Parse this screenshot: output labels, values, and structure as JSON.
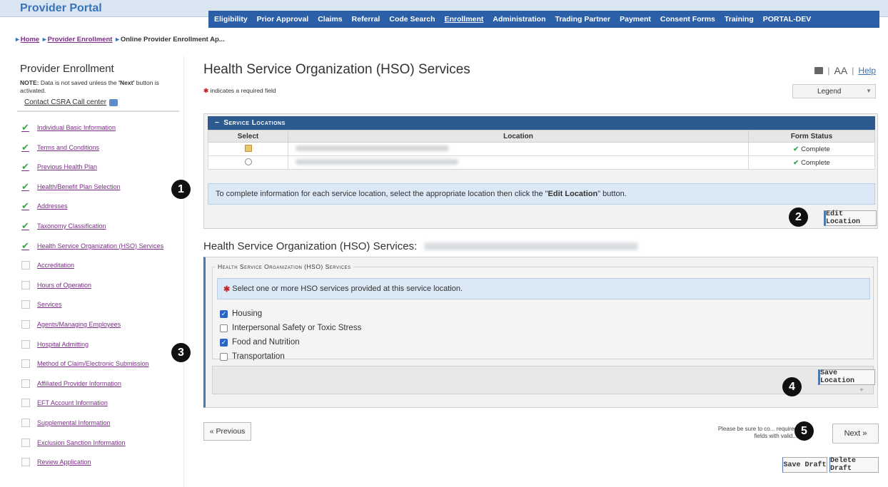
{
  "header": {
    "brand": "Provider Portal",
    "nav": [
      "Eligibility",
      "Prior Approval",
      "Claims",
      "Referral",
      "Code Search",
      "Enrollment",
      "Administration",
      "Trading Partner",
      "Payment",
      "Consent Forms",
      "Training",
      "PORTAL-DEV"
    ],
    "active_nav": "Enrollment"
  },
  "breadcrumb": {
    "home": "Home",
    "enrollment": "Provider Enrollment",
    "current": "Online Provider Enrollment Ap..."
  },
  "sidebar": {
    "title": "Provider Enrollment",
    "note_prefix": "NOTE: ",
    "note_text": "Data is not saved unless the ",
    "note_next": "'Next'",
    "note_suffix": " button is activated.",
    "contact": "Contact CSRA Call center",
    "items": [
      {
        "label": "Individual Basic Information",
        "done": true
      },
      {
        "label": "Terms and Conditions",
        "done": true
      },
      {
        "label": "Previous Health Plan",
        "done": true
      },
      {
        "label": "Health/Benefit Plan Selection",
        "done": true
      },
      {
        "label": "Addresses",
        "done": true
      },
      {
        "label": "Taxonomy Classification",
        "done": true
      },
      {
        "label": "Health Service Organization (HSO) Services",
        "done": true
      },
      {
        "label": "Accreditation",
        "done": false
      },
      {
        "label": "Hours of Operation",
        "done": false
      },
      {
        "label": "Services",
        "done": false
      },
      {
        "label": "Agents/Managing Employees",
        "done": false
      },
      {
        "label": "Hospital Admitting",
        "done": false
      },
      {
        "label": "Method of Claim/Electronic Submission",
        "done": false
      },
      {
        "label": "Affiliated Provider Information",
        "done": false
      },
      {
        "label": "EFT Account Information",
        "done": false
      },
      {
        "label": "Supplemental Information",
        "done": false
      },
      {
        "label": "Exclusion Sanction Information",
        "done": false
      },
      {
        "label": "Review Application",
        "done": false
      }
    ]
  },
  "main": {
    "title": "Health Service Organization (HSO) Services",
    "required_note": "indicates a required field",
    "font_size_label": "AA",
    "help": "Help",
    "legend": "Legend",
    "service_locations": {
      "header": "Service Locations",
      "columns": [
        "Select",
        "Location",
        "Form Status"
      ],
      "rows": [
        {
          "status": "Complete"
        },
        {
          "status": "Complete"
        }
      ],
      "info": "To complete information for each service location, select the appropriate location then click the \"",
      "info_bold": "Edit Location",
      "info_end": "\" button.",
      "edit_button": "Edit Location"
    },
    "hso_title": "Health Service Organization (HSO) Services:",
    "hso_legend": "Health Service Organization (HSO) Services",
    "hso_prompt": "Select one or more HSO services provided at this service location.",
    "options": [
      {
        "label": "Housing",
        "checked": true
      },
      {
        "label": "Interpersonal Safety or Toxic Stress",
        "checked": false
      },
      {
        "label": "Food and Nutrition",
        "checked": true
      },
      {
        "label": "Transportation",
        "checked": false
      }
    ],
    "save_location": "Save Location",
    "previous": "« Previous",
    "next": "Next »",
    "sure_note": "Please be sure to co... required fields with valid...",
    "save_draft": "Save Draft",
    "delete_draft": "Delete Draft"
  },
  "callouts": [
    "1",
    "2",
    "3",
    "4",
    "5"
  ]
}
